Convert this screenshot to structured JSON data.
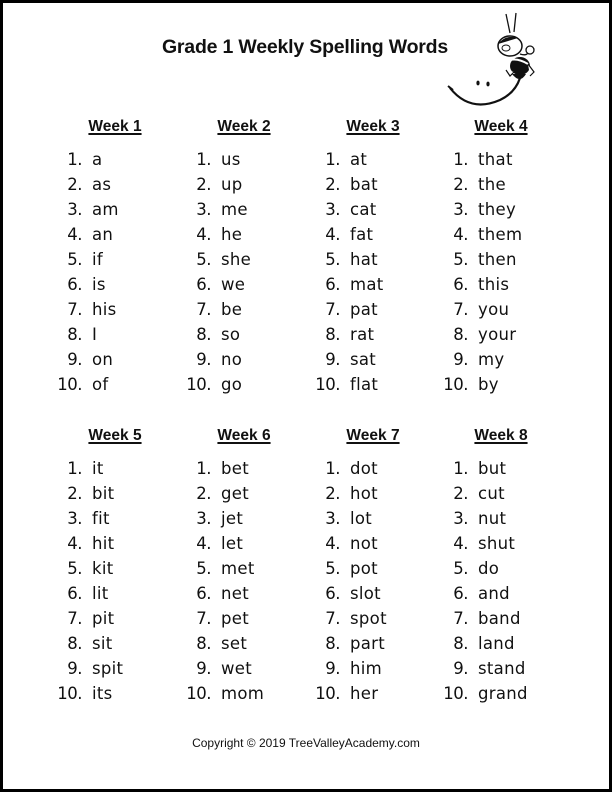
{
  "title": "Grade 1 Weekly Spelling Words",
  "mascot": "bee-on-smiley-icon",
  "weeks": [
    {
      "label": "Week 1",
      "words": [
        "a",
        "as",
        "am",
        "an",
        "if",
        "is",
        "his",
        "I",
        "on",
        "of"
      ]
    },
    {
      "label": "Week 2",
      "words": [
        "us",
        "up",
        "me",
        "he",
        "she",
        "we",
        "be",
        "so",
        "no",
        "go"
      ]
    },
    {
      "label": "Week 3",
      "words": [
        "at",
        "bat",
        "cat",
        "fat",
        "hat",
        "mat",
        "pat",
        "rat",
        "sat",
        "flat"
      ]
    },
    {
      "label": "Week 4",
      "words": [
        "that",
        "the",
        "they",
        "them",
        "then",
        "this",
        "you",
        "your",
        "my",
        "by"
      ]
    },
    {
      "label": "Week 5",
      "words": [
        "it",
        "bit",
        "fit",
        "hit",
        "kit",
        "lit",
        "pit",
        "sit",
        "spit",
        "its"
      ]
    },
    {
      "label": "Week 6",
      "words": [
        "bet",
        "get",
        "jet",
        "let",
        "met",
        "net",
        "pet",
        "set",
        "wet",
        "mom"
      ]
    },
    {
      "label": "Week 7",
      "words": [
        "dot",
        "hot",
        "lot",
        "not",
        "pot",
        "slot",
        "spot",
        "part",
        "him",
        "her"
      ]
    },
    {
      "label": "Week 8",
      "words": [
        "but",
        "cut",
        "nut",
        "shut",
        "do",
        "and",
        "band",
        "land",
        "stand",
        "grand"
      ]
    }
  ],
  "numbers": [
    "1.",
    "2.",
    "3.",
    "4.",
    "5.",
    "6.",
    "7.",
    "8.",
    "9.",
    "10."
  ],
  "copyright": "Copyright © 2019 TreeValleyAcademy.com"
}
